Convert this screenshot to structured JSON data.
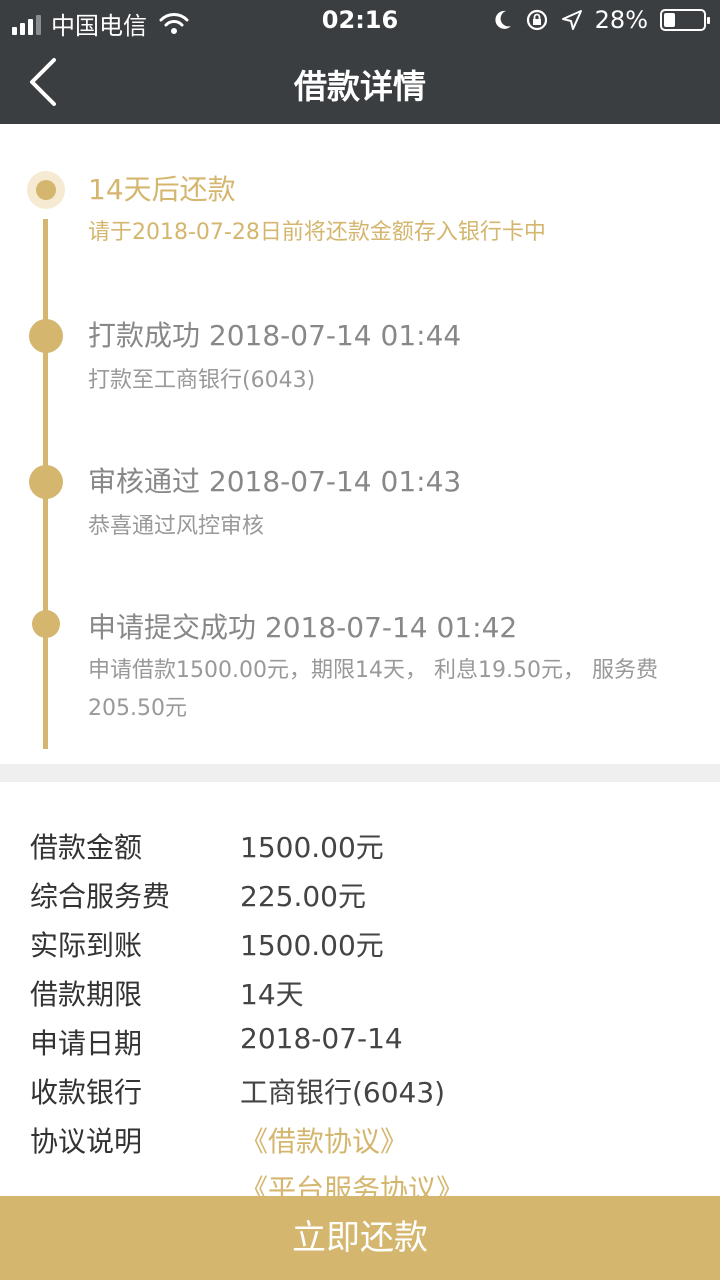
{
  "status_bar": {
    "carrier": "中国电信",
    "time": "02:16",
    "battery": "28%",
    "battery_level": 0.28,
    "icons": [
      "signal-icon",
      "wifi-icon",
      "moon-icon",
      "rotation-lock-icon",
      "location-icon",
      "battery-icon"
    ]
  },
  "nav": {
    "title": "借款详情",
    "back_icon": "chevron-left-icon"
  },
  "timeline": [
    {
      "title": "14天后还款",
      "desc": "请于2018-07-28日前将还款金额存入银行卡中",
      "state": "current"
    },
    {
      "title": "打款成功 2018-07-14 01:44",
      "desc": "打款至工商银行(6043)",
      "state": "done"
    },
    {
      "title": "审核通过 2018-07-14 01:43",
      "desc": "恭喜通过风控审核",
      "state": "done"
    },
    {
      "title": "申请提交成功 2018-07-14 01:42",
      "desc": "申请借款1500.00元，期限14天， 利息19.50元， 服务费205.50元",
      "state": "done"
    }
  ],
  "details": {
    "rows": [
      {
        "label": "借款金额",
        "value": "1500.00元"
      },
      {
        "label": "综合服务费",
        "value": "225.00元"
      },
      {
        "label": "实际到账",
        "value": "1500.00元"
      },
      {
        "label": "借款期限",
        "value": "14天"
      },
      {
        "label": "申请日期",
        "value": "2018-07-14"
      },
      {
        "label": "收款银行",
        "value": "工商银行(6043)"
      }
    ],
    "agreement_label": "协议说明",
    "agreements": [
      "《借款协议》",
      "《平台服务协议》"
    ]
  },
  "repay_button": "立即还款",
  "colors": {
    "accent": "#d4b66e",
    "header": "#3b3e40"
  }
}
